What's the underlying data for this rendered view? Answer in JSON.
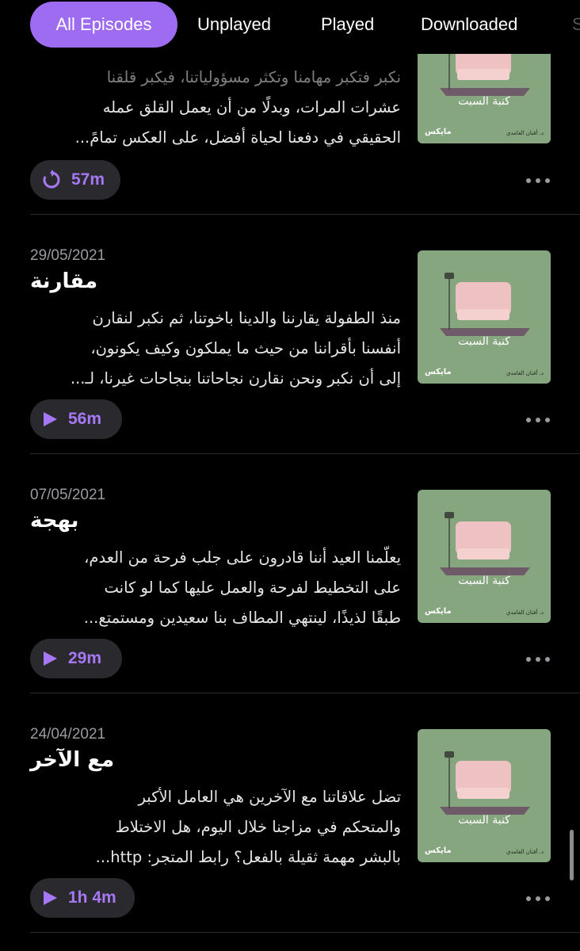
{
  "filters": {
    "items": [
      "All Episodes",
      "Unplayed",
      "Played",
      "Downloaded",
      "S"
    ],
    "active": "All Episodes"
  },
  "colors": {
    "accent": "#9d6cf0",
    "background": "#000000",
    "artwork": "#86a67f",
    "button": "#2a2a2e"
  },
  "artwork": {
    "title": "كنبة السبت",
    "brand": "مايكس",
    "author": "د. أفنان الغامدي"
  },
  "episodes": [
    {
      "date": "",
      "title": "",
      "desc": [
        "نكبر فتكبر مهامنا وتكثر مسؤولياتنا، فيكبر قلقنا",
        "عشرات المرات، وبدلًا من أن يعمل القلق عمله",
        "الحقيقي في دفعنا لحياة أفضل، على العكس تمامً..."
      ],
      "duration": "57m",
      "button_icon": "replay-icon"
    },
    {
      "date": "29/05/2021",
      "title": "مقارنة",
      "desc": [
        "منذ الطفولة يقارننا والدينا باخوتنا، ثم نكبر لنقارن",
        "أنفسنا بأقراننا من حيث ما يملكون وكيف يكونون،",
        "إلى أن نكبر ونحن نقارن نجاحاتنا بنجاحات غيرنا، لـ..."
      ],
      "duration": "56m",
      "button_icon": "play-icon"
    },
    {
      "date": "07/05/2021",
      "title": "بهجة",
      "desc": [
        "يعلّمنا العيد أننا قادرون على جلب فرحة من العدم،",
        "على التخطيط لفرحة والعمل عليها كما لو كانت",
        "طبقًا لذيذًا، لينتهي المطاف بنا سعيدين ومستمتع..."
      ],
      "duration": "29m",
      "button_icon": "play-icon"
    },
    {
      "date": "24/04/2021",
      "title": "مع الآخر",
      "desc": [
        "تضل علاقاتنا مع الآخرين هي العامل الأكبر",
        "والمتحكم في مزاجنا خلال اليوم، هل الاختلاط",
        "بالبشر مهمة ثقيلة بالفعل؟   رابط المتجر:  http..."
      ],
      "duration": "1h 4m",
      "button_icon": "play-icon"
    }
  ]
}
